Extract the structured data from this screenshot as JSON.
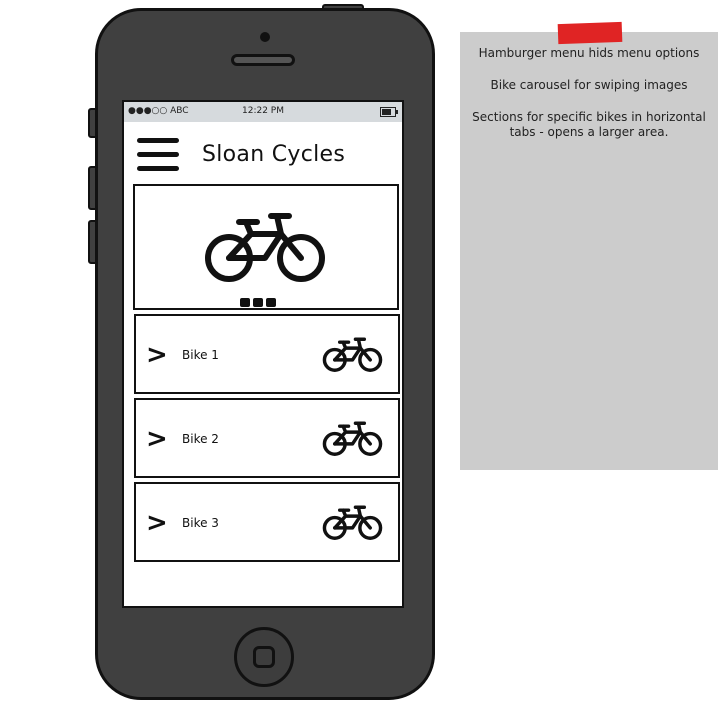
{
  "status_bar": {
    "carrier": "●●●○○ ABC",
    "time": "12:22 PM"
  },
  "header": {
    "title": "Sloan Cycles",
    "menu_icon": "hamburger-icon"
  },
  "carousel": {
    "icon": "bicycle-icon",
    "dots": 3
  },
  "bikes": [
    {
      "label": "Bike 1",
      "chevron": ">",
      "icon": "bicycle-icon"
    },
    {
      "label": "Bike 2",
      "chevron": ">",
      "icon": "bicycle-icon"
    },
    {
      "label": "Bike 3",
      "chevron": ">",
      "icon": "bicycle-icon"
    }
  ],
  "note": {
    "lines": [
      "Hamburger menu hids menu options",
      "Bike carousel for swiping images",
      "Sections for specific bikes in horizontal tabs - opens a larger area."
    ]
  },
  "colors": {
    "phone_body": "#404040",
    "note_bg": "#cccccc",
    "tape": "#e02424",
    "status_bar": "#d6dadd"
  }
}
